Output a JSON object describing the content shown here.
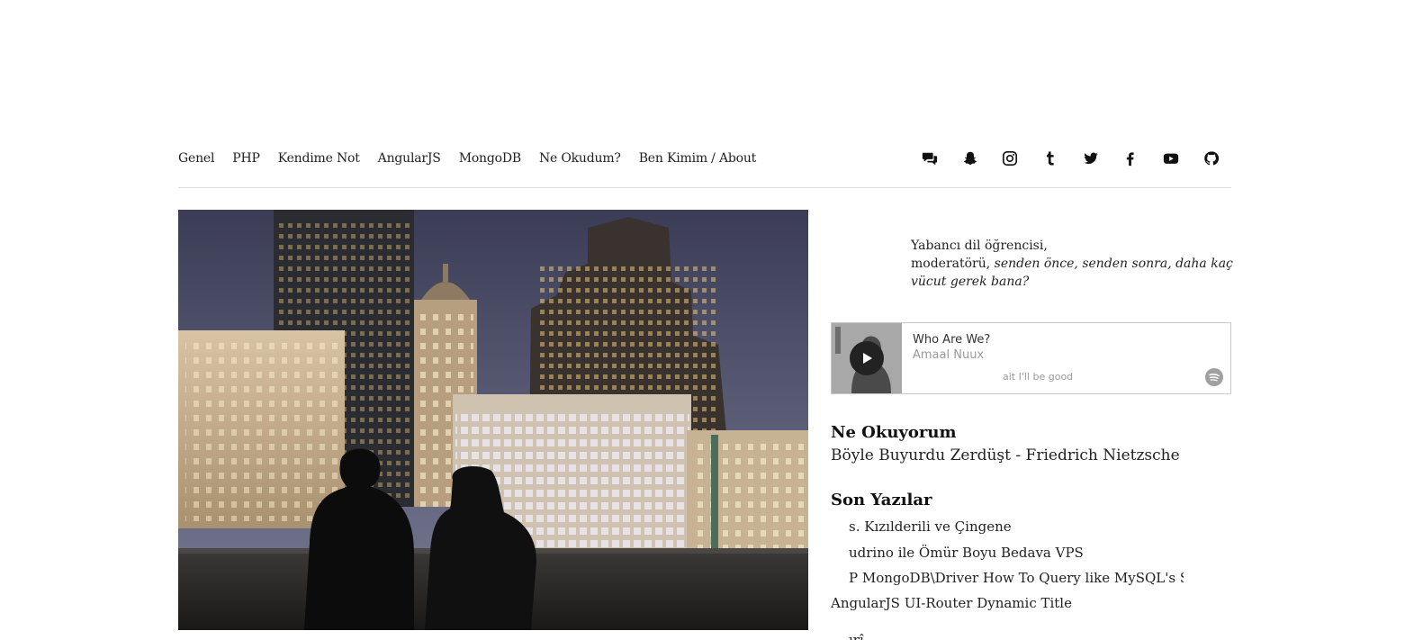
{
  "nav": {
    "items": [
      {
        "label": "Genel"
      },
      {
        "label": "PHP"
      },
      {
        "label": "Kendime Not"
      },
      {
        "label": "AngularJS"
      },
      {
        "label": "MongoDB"
      },
      {
        "label": "Ne Okudum?"
      },
      {
        "label": "Ben Kimim / About"
      }
    ],
    "social_icons": [
      "comments-icon",
      "snapchat-icon",
      "instagram-icon",
      "tumblr-icon",
      "twitter-icon",
      "facebook-icon",
      "youtube-icon",
      "github-icon"
    ]
  },
  "quote": {
    "line1": "Yabancı dil öğrencisi,",
    "line2_plain": "moderatörü, ",
    "line2_italic": "senden önce, senden sonra, daha kaç vücut gerek bana?"
  },
  "player": {
    "title": "Who Are We?",
    "artist": "Amaal Nuux",
    "lyric": "ait I'll be good"
  },
  "reading": {
    "heading": "Ne Okuyorum",
    "book": "Böyle Buyurdu Zerdüşt - Friedrich Nietzsche"
  },
  "recent": {
    "heading": "Son Yazılar",
    "posts": [
      {
        "label": "s. Kızılderili ve Çingene"
      },
      {
        "label": "udrino ile Ömür Boyu Bedava VPS"
      },
      {
        "label": "P MongoDB\\Driver How To Query like MySQL's Select"
      },
      {
        "label": "AngularJS UI-Router Dynamic Title"
      },
      {
        "label": "ırî"
      }
    ]
  },
  "colors": {
    "text": "#222222",
    "border": "#dddddd",
    "accent": "#111111"
  }
}
